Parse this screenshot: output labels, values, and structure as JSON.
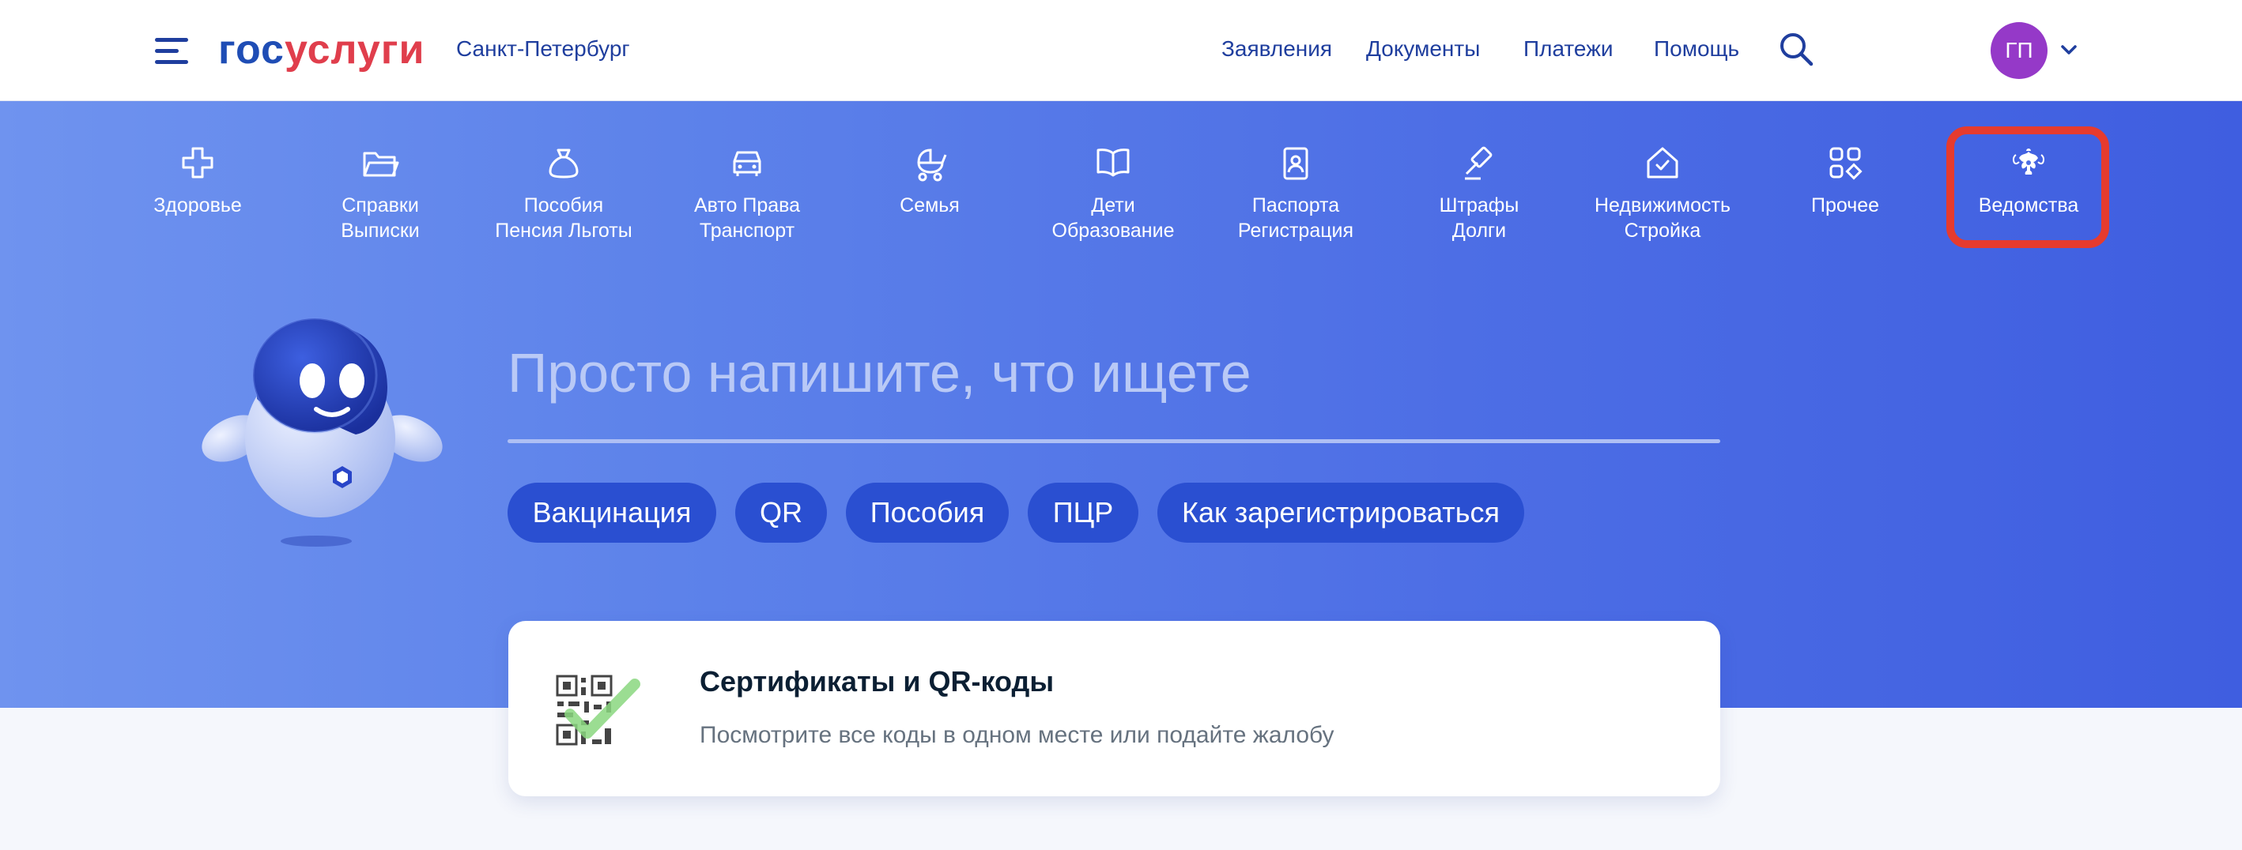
{
  "header": {
    "logo_part1": "гос",
    "logo_part2": "услуги",
    "city": "Санкт-Петербург",
    "nav": [
      "Заявления",
      "Документы",
      "Платежи",
      "Помощь"
    ],
    "avatar_initials": "ГП"
  },
  "categories": [
    {
      "label": "Здоровье",
      "icon": "health-cross-icon"
    },
    {
      "label": "Справки\nВыписки",
      "icon": "folder-icon"
    },
    {
      "label": "Пособия\nПенсия Льготы",
      "icon": "money-bag-icon"
    },
    {
      "label": "Авто Права\nТранспорт",
      "icon": "car-icon"
    },
    {
      "label": "Семья",
      "icon": "stroller-icon"
    },
    {
      "label": "Дети\nОбразование",
      "icon": "book-icon"
    },
    {
      "label": "Паспорта\nРегистрация",
      "icon": "passport-icon"
    },
    {
      "label": "Штрафы\nДолги",
      "icon": "gavel-icon"
    },
    {
      "label": "Недвижимость\nСтройка",
      "icon": "house-icon"
    },
    {
      "label": "Прочее",
      "icon": "grid-icon"
    },
    {
      "label": "Ведомства",
      "icon": "coat-of-arms-icon"
    }
  ],
  "search": {
    "placeholder": "Просто напишите, что ищете"
  },
  "chips": [
    "Вакцинация",
    "QR",
    "Пособия",
    "ПЦР",
    "Как зарегистрироваться"
  ],
  "card": {
    "title": "Сертификаты и QR-коды",
    "subtitle": "Посмотрите все коды в одном месте или подайте жалобу",
    "icon": "qr-check-icon"
  },
  "colors": {
    "brand_blue": "#1f4db5",
    "brand_red": "#e03e4c",
    "hero_start": "#6f93ef",
    "hero_end": "#3f5ee0",
    "chip_bg": "#2a4fd1",
    "highlight": "#e63b2e",
    "avatar": "#9539c8"
  }
}
